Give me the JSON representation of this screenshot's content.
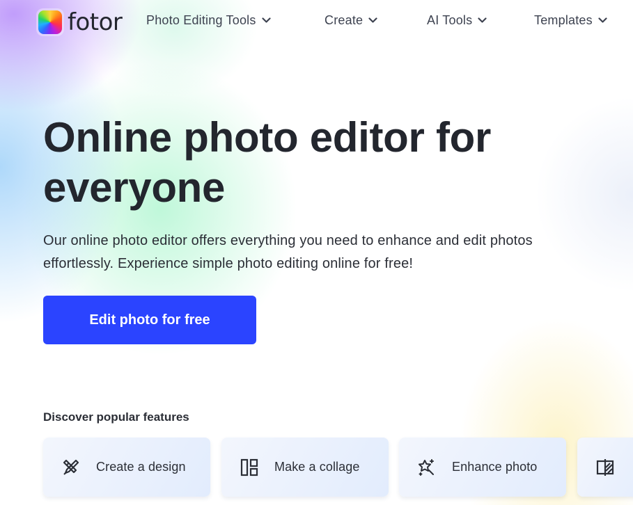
{
  "brand": {
    "name": "fotor",
    "logo_icon": "rainbow-wheel-logo",
    "accent_color": "#2b44ff"
  },
  "nav": {
    "items": [
      {
        "label": "Photo Editing Tools",
        "icon": "chevron-down-icon"
      },
      {
        "label": "Create",
        "icon": "chevron-down-icon"
      },
      {
        "label": "AI Tools",
        "icon": "chevron-down-icon"
      },
      {
        "label": "Templates",
        "icon": "chevron-down-icon"
      }
    ]
  },
  "hero": {
    "title": "Online photo editor for everyone",
    "description": "Our online photo editor offers everything you need to enhance and edit photos effortlessly. Experience simple photo editing online for free!",
    "cta_label": "Edit photo for free"
  },
  "features": {
    "title": "Discover popular features",
    "cards": [
      {
        "label": "Create a design",
        "icon": "pencil-ruler-icon"
      },
      {
        "label": "Make a collage",
        "icon": "collage-layout-icon"
      },
      {
        "label": "Enhance photo",
        "icon": "magic-wand-sparkle-icon"
      },
      {
        "label": "",
        "icon": "before-after-compare-icon"
      }
    ]
  }
}
